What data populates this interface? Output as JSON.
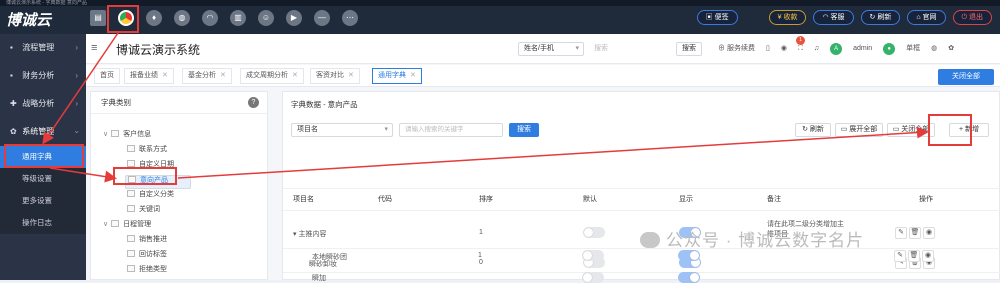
{
  "window": {
    "title": "博诚云演示系统 - 字典数据 意向产品"
  },
  "topbar": {
    "logo": "博诚云",
    "icons": [
      "folder-icon",
      "chrome-icon",
      "bottle-icon",
      "globe-icon",
      "headset-icon",
      "chart-icon",
      "users-icon",
      "play-icon",
      "minus-icon",
      "dots-icon"
    ],
    "pills": [
      {
        "label": "便签",
        "icon": "note-icon"
      },
      {
        "label": "¥ 收款",
        "icon": "yen-icon"
      },
      {
        "label": "客服",
        "icon": "headset-icon"
      },
      {
        "label": "刷新",
        "icon": "refresh-icon"
      },
      {
        "label": "官网",
        "icon": "home-icon"
      },
      {
        "label": "退出",
        "icon": "exit-icon"
      }
    ]
  },
  "sidebar": {
    "items": [
      {
        "label": "流程管理",
        "icon": "flow-icon"
      },
      {
        "label": "财务分析",
        "icon": "finance-icon"
      },
      {
        "label": "战略分析",
        "icon": "strategy-icon"
      },
      {
        "label": "系统管理",
        "icon": "gear-icon"
      }
    ],
    "subitems": [
      "通用字典",
      "等级设置",
      "更多设置",
      "操作日志"
    ]
  },
  "header": {
    "title": "博诚云演示系统",
    "search_select": "姓名/手机",
    "search_placeholder": "搜索",
    "search_button": "搜索",
    "service_label": "服务续费",
    "notify_count": "1",
    "user": "admin",
    "avatar_letter": "A",
    "mode": "单框",
    "lang_icon": "globe-icon",
    "settings_icon": "gear-icon"
  },
  "tabs": [
    {
      "label": "首页",
      "closable": false
    },
    {
      "label": "报备业绩",
      "closable": true
    },
    {
      "label": "基金分析",
      "closable": true
    },
    {
      "label": "成交周期分析",
      "closable": true
    },
    {
      "label": "客资对比",
      "closable": true
    },
    {
      "label": "通用字典",
      "closable": true,
      "active": true
    }
  ],
  "close_all": "关闭全部",
  "left_panel": {
    "title": "字典类别",
    "help": "?",
    "tree": [
      {
        "label": "客户信息",
        "level": 0,
        "expanded": true
      },
      {
        "label": "联系方式",
        "level": 1
      },
      {
        "label": "自定义日期",
        "level": 1
      },
      {
        "label": "意向产品",
        "level": 1,
        "selected": true
      },
      {
        "label": "自定义分类",
        "level": 1
      },
      {
        "label": "关键词",
        "level": 1
      },
      {
        "label": "日程管理",
        "level": 0,
        "expanded": true
      },
      {
        "label": "销售推进",
        "level": 1
      },
      {
        "label": "回访标签",
        "level": 1
      },
      {
        "label": "拒绝类型",
        "level": 1
      }
    ]
  },
  "right_panel": {
    "title": "字典数据 - 意向产品",
    "filter_select": "项目名",
    "filter_placeholder": "请输入搜索的关键字",
    "search_button": "搜索",
    "refresh": "刷新",
    "expand_all": "展开全部",
    "collapse_all": "关闭全部",
    "add": "+ 新增",
    "columns": [
      "项目名",
      "代码",
      "排序",
      "默认",
      "显示",
      "备注",
      "操作"
    ],
    "rows": [
      {
        "name": "▾ 主推内容",
        "code": "",
        "sort": "1",
        "default": false,
        "show": true,
        "note": "请在此项二级分类增加主推项目"
      },
      {
        "name": "瞬砂卸妆",
        "code": "",
        "sort": "0",
        "default": false,
        "show": true,
        "note": ""
      },
      {
        "name": "本地瞬砂团",
        "code": "",
        "sort": "1",
        "default": false,
        "show": true,
        "note": ""
      },
      {
        "name": "瞬加",
        "code": "",
        "sort": "",
        "default": false,
        "show": true,
        "note": ""
      }
    ]
  },
  "watermark": "公众号 · 博诚云数字名片"
}
